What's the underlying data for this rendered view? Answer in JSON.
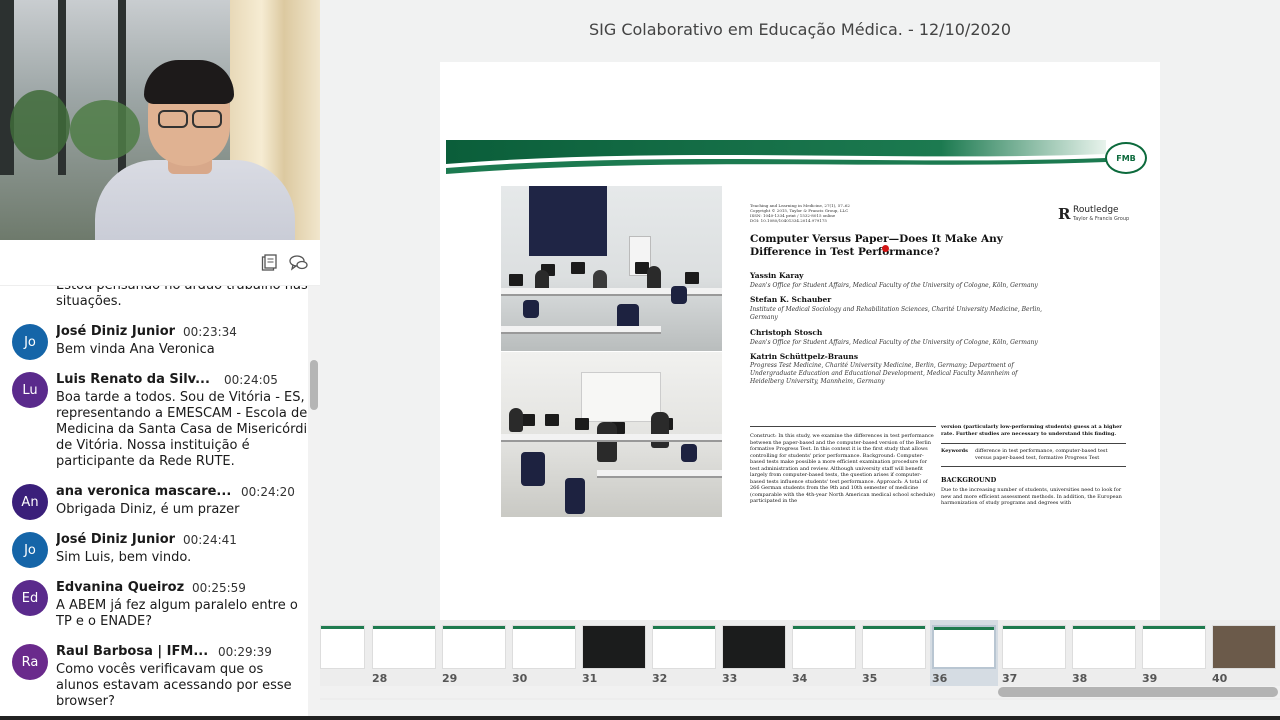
{
  "header": {
    "title": "SIG Colaborativo em Educação Médica. - 12/10/2020"
  },
  "toolbar": {
    "icons": [
      "clipboard-icon",
      "chat-bubbles-icon"
    ]
  },
  "chat": {
    "partial_message": "Estou pensando no árduo trabalho nas situações.",
    "messages": [
      {
        "initials": "Jo",
        "name": "José Diniz Junior",
        "time": "00:23:34",
        "text": "Bem vinda Ana Veronica",
        "color": "#1565a8"
      },
      {
        "initials": "Lu",
        "name": "Luis Renato da Silv...",
        "time": "00:24:05",
        "text": "Boa tarde a todos. Sou de Vitória - ES,\nrepresentando a EMESCAM - Escola de\nMedicina da Santa Casa de Misericórdi\nde Vitória. Nossa instituição é\nparticipante da Rede RUTE.",
        "color": "#5a2a8c"
      },
      {
        "initials": "An",
        "name": "ana veronica mascare...",
        "time": "00:24:20",
        "text": "Obrigada Diniz, é um prazer",
        "color": "#3a1f7a"
      },
      {
        "initials": "Jo",
        "name": "José Diniz Junior",
        "time": "00:24:41",
        "text": "Sim Luis, bem vindo.",
        "color": "#1565a8"
      },
      {
        "initials": "Ed",
        "name": "Edvanina Queiroz",
        "time": "00:25:59",
        "text": "A ABEM já fez algum paralelo entre o\nTP e o ENADE?",
        "color": "#5a2a8c"
      },
      {
        "initials": "Ra",
        "name": "Raul Barbosa | IFM...",
        "time": "00:29:39",
        "text": "Como vocês verificavam que os\nalunos estavam acessando por esse\nbrowser?",
        "color": "#6a2a8c"
      }
    ]
  },
  "slide": {
    "logo_text": "FMB",
    "publisher": {
      "letter": "R",
      "name": "Routledge",
      "sub": "Taylor & Francis Group"
    },
    "meta": "Teaching and Learning in Medicine, 27(1), 57–62\nCopyright © 2015, Taylor & Francis Group, LLC\nISSN: 1040-1334 print / 1532-8015 online\nDOI: 10.1080/10401334.2014.979175",
    "title": "Computer Versus Paper—Does It Make Any Difference in Test Performance?",
    "authors": [
      {
        "name": "Yassin Karay",
        "aff": "Dean's Office for Student Affairs, Medical Faculty of the University of Cologne, Köln, Germany"
      },
      {
        "name": "Stefan K. Schauber",
        "aff": "Institute of Medical Sociology and Rehabilitation Sciences, Charité University Medicine, Berlin, Germany"
      },
      {
        "name": "Christoph Stosch",
        "aff": "Dean's Office for Student Affairs, Medical Faculty of the University of Cologne, Köln, Germany"
      },
      {
        "name": "Katrin Schüttpelz-Brauns",
        "aff": "Progress Test Medicine, Charité University Medicine, Berlin, Germany; Department of Undergraduate Education and Educational Development, Medical Faculty Mannheim of Heidelberg University, Mannheim, Germany"
      }
    ],
    "abstract": "Construct: In this study, we examine the differences in test performance between the paper-based and the computer-based version of the Berlin formative Progress Test. In this context it is the first study that allows controlling for students' prior performance. Background: Computer-based tests make possible a more efficient examination procedure for test administration and review. Although university staff will benefit largely from computer-based tests, the question arises if computer-based tests influence students' test performance. Approach: A total of 266 German students from the 9th and 10th semester of medicine (comparable with the 4th-year North American medical school schedule) participated in the",
    "abstract_cont": "version (particularly low-performing students) guess at a higher rate. Further studies are necessary to understand this finding.",
    "keywords_label": "Keywords",
    "keywords": "difference in test performance, computer-based test versus paper-based test, formative Progress Test",
    "background_heading": "BACKGROUND",
    "background": "Due to the increasing number of students, universities need to look for new and more efficient assessment methods. In addition, the European harmonization of study programs and degrees with"
  },
  "filmstrip": {
    "pages": [
      "28",
      "29",
      "30",
      "31",
      "32",
      "33",
      "34",
      "35",
      "36",
      "37",
      "38",
      "39",
      "40"
    ],
    "active": "36"
  }
}
